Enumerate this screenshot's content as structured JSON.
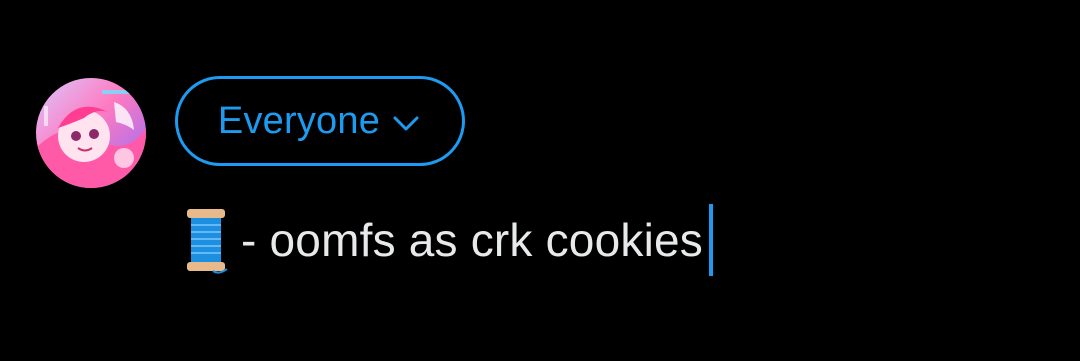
{
  "composer": {
    "avatar_icon": "user-avatar",
    "audience_selector": {
      "label": "Everyone",
      "icon": "chevron-down-icon",
      "color": "#1d9bf0"
    },
    "compose": {
      "leading_icon": "spool-of-thread-emoji",
      "text": "- oomfs as crk cookies",
      "text_color": "#e7e9ea",
      "caret_color": "#1d9bf0"
    }
  }
}
